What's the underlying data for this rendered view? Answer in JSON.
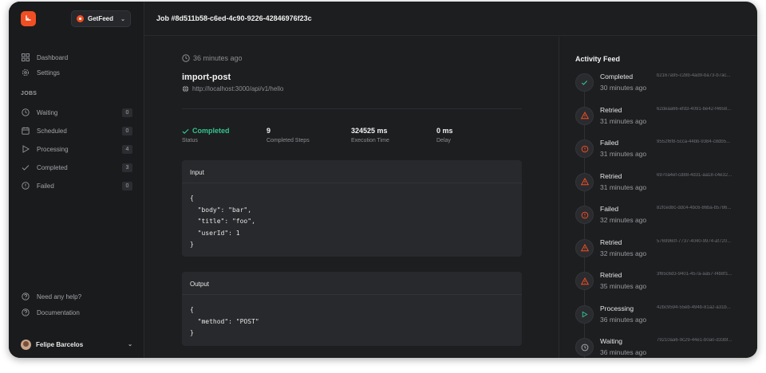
{
  "sidebar": {
    "project": "GetFeed",
    "nav": [
      {
        "label": "Dashboard",
        "icon": "grid-icon"
      },
      {
        "label": "Settings",
        "icon": "gear-icon"
      }
    ],
    "jobs_label": "JOBS",
    "jobs": [
      {
        "label": "Waiting",
        "count": "0",
        "icon": "clock-icon"
      },
      {
        "label": "Scheduled",
        "count": "0",
        "icon": "calendar-icon"
      },
      {
        "label": "Processing",
        "count": "4",
        "icon": "play-icon"
      },
      {
        "label": "Completed",
        "count": "3",
        "icon": "check-icon"
      },
      {
        "label": "Failed",
        "count": "0",
        "icon": "alert-circle-icon"
      }
    ],
    "help": [
      {
        "label": "Need any help?",
        "icon": "help-icon"
      },
      {
        "label": "Documentation",
        "icon": "help-icon"
      }
    ],
    "user": "Felipe Barcelos"
  },
  "header": {
    "title": "Job #8d511b58-c6ed-4c90-9226-42846976f23c"
  },
  "job": {
    "time_ago": "36 minutes ago",
    "name": "import-post",
    "url": "http://localhost:3000/api/v1/hello",
    "stats": [
      {
        "value": "Completed",
        "label": "Status"
      },
      {
        "value": "9",
        "label": "Completed Steps"
      },
      {
        "value": "324525 ms",
        "label": "Execution Time"
      },
      {
        "value": "0 ms",
        "label": "Delay"
      }
    ],
    "input_label": "Input",
    "input": "{\n  \"body\": \"bar\",\n  \"title\": \"foo\",\n  \"userId\": 1\n}",
    "output_label": "Output",
    "output": "{\n  \"method\": \"POST\"\n}"
  },
  "feed": {
    "title": "Activity Feed",
    "items": [
      {
        "status": "Completed",
        "ago": "30 minutes ago",
        "id": "b2167a95-c28b-4ad9-ba73-b7ac...",
        "kind": "check"
      },
      {
        "status": "Retried",
        "ago": "31 minutes ago",
        "id": "62deaa66-efd3-4091-be42-f4658...",
        "kind": "warn"
      },
      {
        "status": "Failed",
        "ago": "31 minutes ago",
        "id": "9552f6f8-5cca-44bb-9384-c8db5...",
        "kind": "fail"
      },
      {
        "status": "Retried",
        "ago": "31 minutes ago",
        "id": "6970a4ef-cd88-4d31-aa18-c4e32...",
        "kind": "warn"
      },
      {
        "status": "Failed",
        "ago": "32 minutes ago",
        "id": "82fced8c-ddc4-4bc6-86ba-b5786...",
        "kind": "fail"
      },
      {
        "status": "Retried",
        "ago": "32 minutes ago",
        "id": "5769960f-7737-4040-9974-af720...",
        "kind": "warn"
      },
      {
        "status": "Retried",
        "ago": "35 minutes ago",
        "id": "3f65c6d3-9401-457a-aa57-f4b8f1...",
        "kind": "warn"
      },
      {
        "status": "Processing",
        "ago": "36 minutes ago",
        "id": "42bc9594-55eb-494b-81a2-a31b...",
        "kind": "play"
      },
      {
        "status": "Waiting",
        "ago": "36 minutes ago",
        "id": "79210aa6-9c29-44e1-b0a0-d33bf...",
        "kind": "clock"
      }
    ]
  },
  "colors": {
    "accent": "#f04e23",
    "success": "#33c58e",
    "warn": "#f04e23",
    "background": "#1d1e20"
  }
}
